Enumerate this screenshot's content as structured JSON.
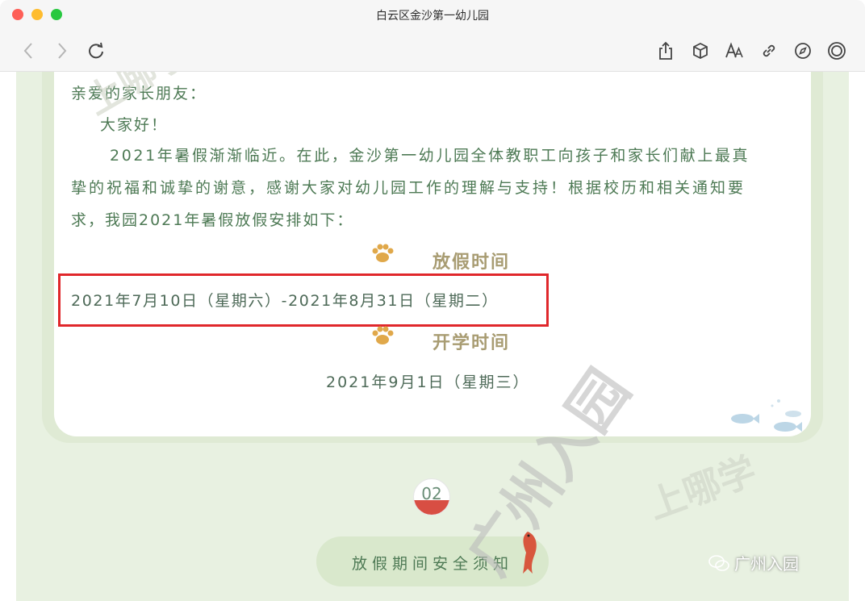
{
  "window": {
    "title": "白云区金沙第一幼儿园"
  },
  "toolbar": {
    "back_icon": "chevron-left-icon",
    "forward_icon": "chevron-right-icon",
    "reload_icon": "reload-icon",
    "share_icon": "share-icon",
    "box_icon": "cube-icon",
    "font_icon": "font-size-icon",
    "link_icon": "link-icon",
    "compass_icon": "compass-icon",
    "more_icon": "circle-icon"
  },
  "letter": {
    "greeting": "亲爱的家长朋友：",
    "hello": "大家好！",
    "line1": "2021年暑假渐渐临近。在此，金沙第一幼儿园全体教职工向孩子和家长们献上最真",
    "line2": "挚的祝福和诚挚的谢意，感谢大家对幼儿园工作的理解与支持！根据校历和相关通知要",
    "line3": "求，我园2021年暑假放假安排如下："
  },
  "holiday": {
    "title": "放假时间",
    "dates": "2021年7月10日（星期六）-2021年8月31日（星期二）"
  },
  "school_start": {
    "title": "开学时间",
    "date": "2021年9月1日（星期三）"
  },
  "section2": {
    "number": "02",
    "label": "放假期间安全须知"
  },
  "watermarks": {
    "brand1": "上哪学",
    "brand2": "广州入园",
    "brand3": "上哪学",
    "wechat_label": "广州入园"
  },
  "colors": {
    "text_green": "#4e7a55",
    "gold": "#a89c72",
    "highlight_red": "#e0272b",
    "bg_green": "#e8f1e1"
  }
}
